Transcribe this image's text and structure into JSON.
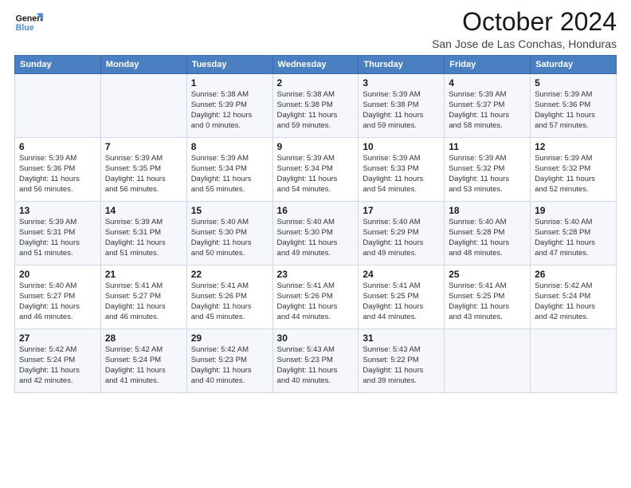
{
  "header": {
    "logo_line1": "General",
    "logo_line2": "Blue",
    "month": "October 2024",
    "location": "San Jose de Las Conchas, Honduras"
  },
  "days_of_week": [
    "Sunday",
    "Monday",
    "Tuesday",
    "Wednesday",
    "Thursday",
    "Friday",
    "Saturday"
  ],
  "weeks": [
    [
      {
        "day": "",
        "info": ""
      },
      {
        "day": "",
        "info": ""
      },
      {
        "day": "1",
        "info": "Sunrise: 5:38 AM\nSunset: 5:39 PM\nDaylight: 12 hours\nand 0 minutes."
      },
      {
        "day": "2",
        "info": "Sunrise: 5:38 AM\nSunset: 5:38 PM\nDaylight: 11 hours\nand 59 minutes."
      },
      {
        "day": "3",
        "info": "Sunrise: 5:39 AM\nSunset: 5:38 PM\nDaylight: 11 hours\nand 59 minutes."
      },
      {
        "day": "4",
        "info": "Sunrise: 5:39 AM\nSunset: 5:37 PM\nDaylight: 11 hours\nand 58 minutes."
      },
      {
        "day": "5",
        "info": "Sunrise: 5:39 AM\nSunset: 5:36 PM\nDaylight: 11 hours\nand 57 minutes."
      }
    ],
    [
      {
        "day": "6",
        "info": "Sunrise: 5:39 AM\nSunset: 5:36 PM\nDaylight: 11 hours\nand 56 minutes."
      },
      {
        "day": "7",
        "info": "Sunrise: 5:39 AM\nSunset: 5:35 PM\nDaylight: 11 hours\nand 56 minutes."
      },
      {
        "day": "8",
        "info": "Sunrise: 5:39 AM\nSunset: 5:34 PM\nDaylight: 11 hours\nand 55 minutes."
      },
      {
        "day": "9",
        "info": "Sunrise: 5:39 AM\nSunset: 5:34 PM\nDaylight: 11 hours\nand 54 minutes."
      },
      {
        "day": "10",
        "info": "Sunrise: 5:39 AM\nSunset: 5:33 PM\nDaylight: 11 hours\nand 54 minutes."
      },
      {
        "day": "11",
        "info": "Sunrise: 5:39 AM\nSunset: 5:32 PM\nDaylight: 11 hours\nand 53 minutes."
      },
      {
        "day": "12",
        "info": "Sunrise: 5:39 AM\nSunset: 5:32 PM\nDaylight: 11 hours\nand 52 minutes."
      }
    ],
    [
      {
        "day": "13",
        "info": "Sunrise: 5:39 AM\nSunset: 5:31 PM\nDaylight: 11 hours\nand 51 minutes."
      },
      {
        "day": "14",
        "info": "Sunrise: 5:39 AM\nSunset: 5:31 PM\nDaylight: 11 hours\nand 51 minutes."
      },
      {
        "day": "15",
        "info": "Sunrise: 5:40 AM\nSunset: 5:30 PM\nDaylight: 11 hours\nand 50 minutes."
      },
      {
        "day": "16",
        "info": "Sunrise: 5:40 AM\nSunset: 5:30 PM\nDaylight: 11 hours\nand 49 minutes."
      },
      {
        "day": "17",
        "info": "Sunrise: 5:40 AM\nSunset: 5:29 PM\nDaylight: 11 hours\nand 49 minutes."
      },
      {
        "day": "18",
        "info": "Sunrise: 5:40 AM\nSunset: 5:28 PM\nDaylight: 11 hours\nand 48 minutes."
      },
      {
        "day": "19",
        "info": "Sunrise: 5:40 AM\nSunset: 5:28 PM\nDaylight: 11 hours\nand 47 minutes."
      }
    ],
    [
      {
        "day": "20",
        "info": "Sunrise: 5:40 AM\nSunset: 5:27 PM\nDaylight: 11 hours\nand 46 minutes."
      },
      {
        "day": "21",
        "info": "Sunrise: 5:41 AM\nSunset: 5:27 PM\nDaylight: 11 hours\nand 46 minutes."
      },
      {
        "day": "22",
        "info": "Sunrise: 5:41 AM\nSunset: 5:26 PM\nDaylight: 11 hours\nand 45 minutes."
      },
      {
        "day": "23",
        "info": "Sunrise: 5:41 AM\nSunset: 5:26 PM\nDaylight: 11 hours\nand 44 minutes."
      },
      {
        "day": "24",
        "info": "Sunrise: 5:41 AM\nSunset: 5:25 PM\nDaylight: 11 hours\nand 44 minutes."
      },
      {
        "day": "25",
        "info": "Sunrise: 5:41 AM\nSunset: 5:25 PM\nDaylight: 11 hours\nand 43 minutes."
      },
      {
        "day": "26",
        "info": "Sunrise: 5:42 AM\nSunset: 5:24 PM\nDaylight: 11 hours\nand 42 minutes."
      }
    ],
    [
      {
        "day": "27",
        "info": "Sunrise: 5:42 AM\nSunset: 5:24 PM\nDaylight: 11 hours\nand 42 minutes."
      },
      {
        "day": "28",
        "info": "Sunrise: 5:42 AM\nSunset: 5:24 PM\nDaylight: 11 hours\nand 41 minutes."
      },
      {
        "day": "29",
        "info": "Sunrise: 5:42 AM\nSunset: 5:23 PM\nDaylight: 11 hours\nand 40 minutes."
      },
      {
        "day": "30",
        "info": "Sunrise: 5:43 AM\nSunset: 5:23 PM\nDaylight: 11 hours\nand 40 minutes."
      },
      {
        "day": "31",
        "info": "Sunrise: 5:43 AM\nSunset: 5:22 PM\nDaylight: 11 hours\nand 39 minutes."
      },
      {
        "day": "",
        "info": ""
      },
      {
        "day": "",
        "info": ""
      }
    ]
  ]
}
